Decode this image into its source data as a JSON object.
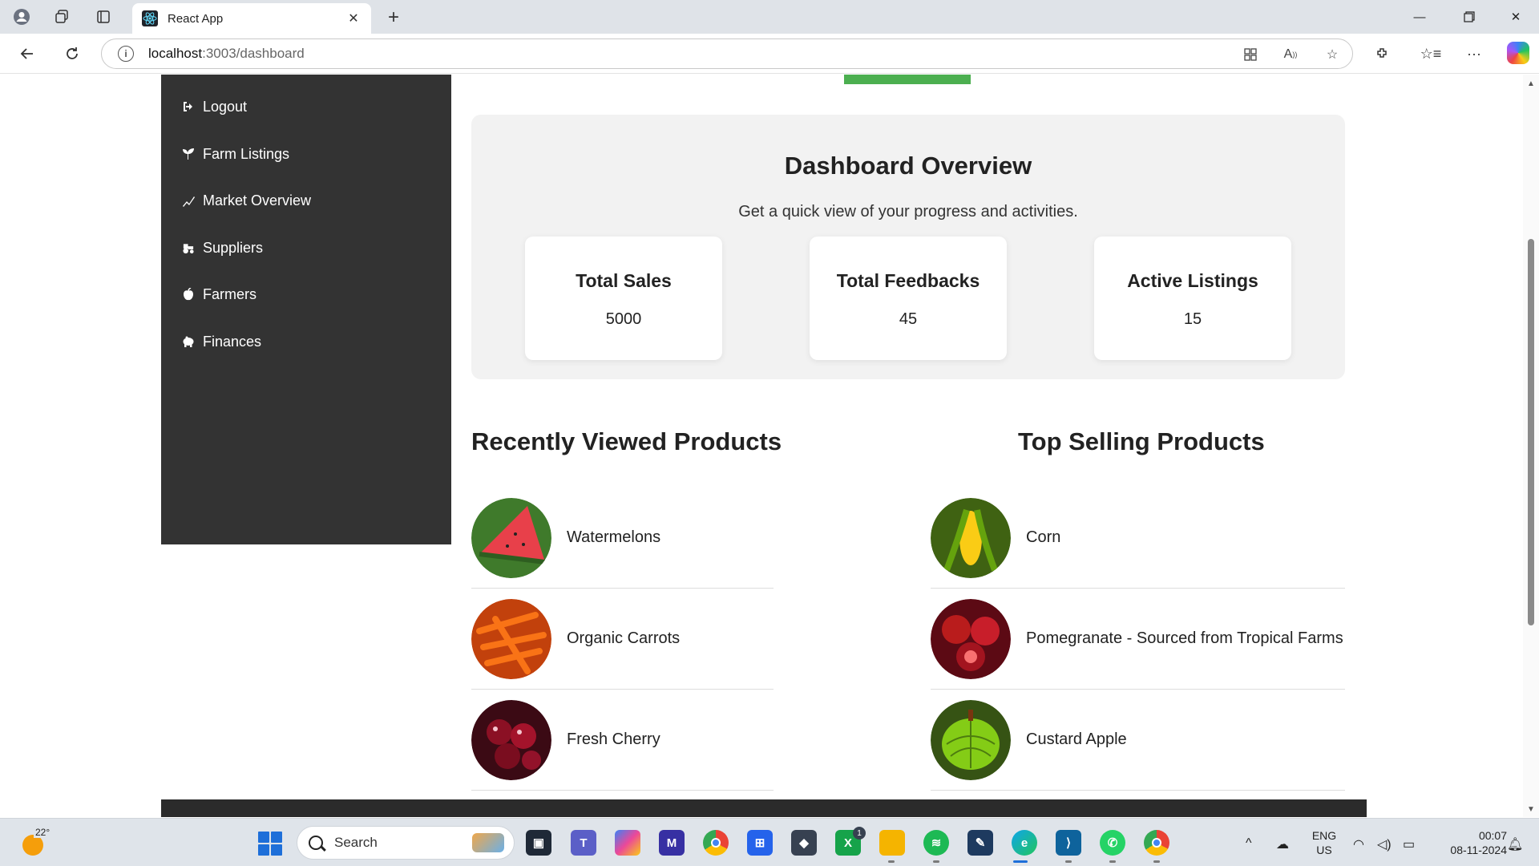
{
  "browser": {
    "tab_title": "React App",
    "url_host": "localhost",
    "url_path": ":3003/dashboard"
  },
  "sidebar": {
    "items": [
      {
        "label": "Logout",
        "icon": "logout-icon"
      },
      {
        "label": "Farm Listings",
        "icon": "sprout-icon"
      },
      {
        "label": "Market Overview",
        "icon": "chart-icon"
      },
      {
        "label": "Suppliers",
        "icon": "tractor-icon"
      },
      {
        "label": "Farmers",
        "icon": "apple-icon"
      },
      {
        "label": "Finances",
        "icon": "piggy-bank-icon"
      }
    ]
  },
  "overview": {
    "title": "Dashboard Overview",
    "subtitle": "Get a quick view of your progress and activities.",
    "stats": [
      {
        "label": "Total Sales",
        "value": "5000"
      },
      {
        "label": "Total Feedbacks",
        "value": "45"
      },
      {
        "label": "Active Listings",
        "value": "15"
      }
    ]
  },
  "recent": {
    "title": "Recently Viewed Products",
    "items": [
      {
        "name": "Watermelons"
      },
      {
        "name": "Organic Carrots"
      },
      {
        "name": "Fresh Cherry"
      }
    ]
  },
  "top_selling": {
    "title": "Top Selling Products",
    "items": [
      {
        "name": "Corn"
      },
      {
        "name": "Pomegranate - Sourced from Tropical Farms"
      },
      {
        "name": "Custard Apple"
      }
    ]
  },
  "taskbar": {
    "weather_temp": "22°",
    "search_placeholder": "Search",
    "lang_line1": "ENG",
    "lang_line2": "US",
    "time": "00:07",
    "date": "08-11-2024",
    "xbox_badge": "1"
  },
  "colors": {
    "sidebar_bg": "#333333",
    "accent_green": "#4caf50",
    "overview_bg": "#f2f2f2"
  }
}
